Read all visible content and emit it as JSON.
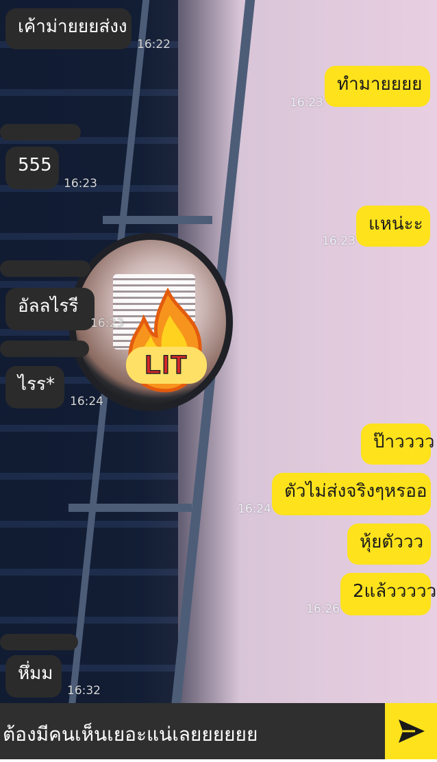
{
  "messages": [
    {
      "text": "เค้าม่ายยยส่งง",
      "time": "16:22",
      "side": "in"
    },
    {
      "text": "ทำมายยยย",
      "time": "16:23",
      "side": "out"
    },
    {
      "text": "555",
      "time": "16:23",
      "side": "in"
    },
    {
      "text": "แหน่ะะ",
      "time": "16:23",
      "side": "out"
    },
    {
      "text": "อัลลไรรี",
      "time": "16:23",
      "side": "in"
    },
    {
      "text": "ไรร*",
      "time": "16:24",
      "side": "in"
    },
    {
      "text": "ป๊าวววว",
      "time": "",
      "side": "out"
    },
    {
      "text": "ตัวไม่ส่งจริงๆหรออ",
      "time": "16:24",
      "side": "out"
    },
    {
      "text": "หุ้ยตัววว",
      "time": "",
      "side": "out"
    },
    {
      "text": "2แล้ววววว",
      "time": "16:26",
      "side": "out"
    },
    {
      "text": "หึ่มม",
      "time": "16:32",
      "side": "in"
    }
  ],
  "sticker": {
    "text": "LIT",
    "icon": "fire-icon"
  },
  "composer": {
    "input_value": "ต้องมีคนเห็นเยอะแน่เลยยยยยย",
    "emoji_icon": "smiley-icon",
    "send_icon": "send-icon"
  },
  "colors": {
    "outgoing": "#fde21c",
    "incoming": "#2b2b2b",
    "composer": "#2f2f2f"
  }
}
